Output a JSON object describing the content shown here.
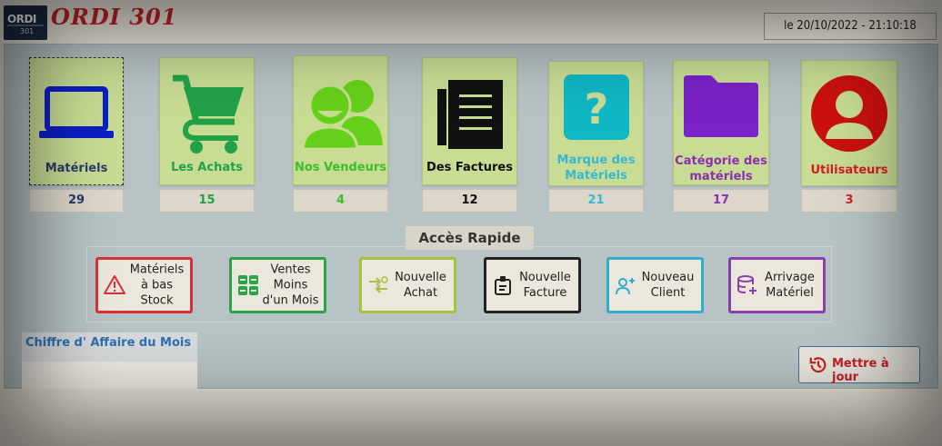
{
  "app": {
    "logo_text": "ORDI",
    "logo_sub": "301",
    "title": "ORDI 301",
    "datetime": "le 20/10/2022 - 21:10:18"
  },
  "tiles": [
    {
      "label": "Matériels",
      "count": "29",
      "icon": "laptop-icon",
      "color": "#2b3a67",
      "icon_color": "#0c1fc4"
    },
    {
      "label": "Les Achats",
      "count": "15",
      "icon": "cart-icon",
      "color": "#22a247",
      "icon_color": "#22a247"
    },
    {
      "label": "Nos Vendeurs",
      "count": "4",
      "icon": "users-icon",
      "color": "#3bbf2a",
      "icon_color": "#66d11a"
    },
    {
      "label": "Des Factures",
      "count": "12",
      "icon": "invoice-icon",
      "color": "#111111",
      "icon_color": "#111111"
    },
    {
      "label": "Marque des Matériels",
      "count": "21",
      "icon": "question-icon",
      "color": "#3bb6d1",
      "icon_color": "#10b7c4"
    },
    {
      "label": "Catégorie des matériels",
      "count": "17",
      "icon": "folder-icon",
      "color": "#8a2fb0",
      "icon_color": "#7a23c8"
    },
    {
      "label": "Utilisateurs",
      "count": "3",
      "icon": "user-icon",
      "color": "#d41c24",
      "icon_color": "#cc1010"
    }
  ],
  "quick_access": {
    "title": "Accès Rapide",
    "buttons": [
      {
        "label": "Matériels à bas Stock",
        "icon": "warning-icon",
        "color": "#d93035"
      },
      {
        "label": "Ventes Moins d'un Mois",
        "icon": "grid-icon",
        "color": "#2aa34a"
      },
      {
        "label": "Nouvelle Achat",
        "icon": "exchange-icon",
        "color": "#a6c23a"
      },
      {
        "label": "Nouvelle Facture",
        "icon": "clipboard-icon",
        "color": "#222222"
      },
      {
        "label": "Nouveau Client",
        "icon": "add-user-icon",
        "color": "#31aecd"
      },
      {
        "label": "Arrivage Matériel",
        "icon": "database-add-icon",
        "color": "#8b3fae"
      }
    ]
  },
  "revenue": {
    "title": "Chiffre d' Affaire du Mois"
  },
  "update_button": {
    "label": "Mettre à jour",
    "icon": "history-icon"
  }
}
